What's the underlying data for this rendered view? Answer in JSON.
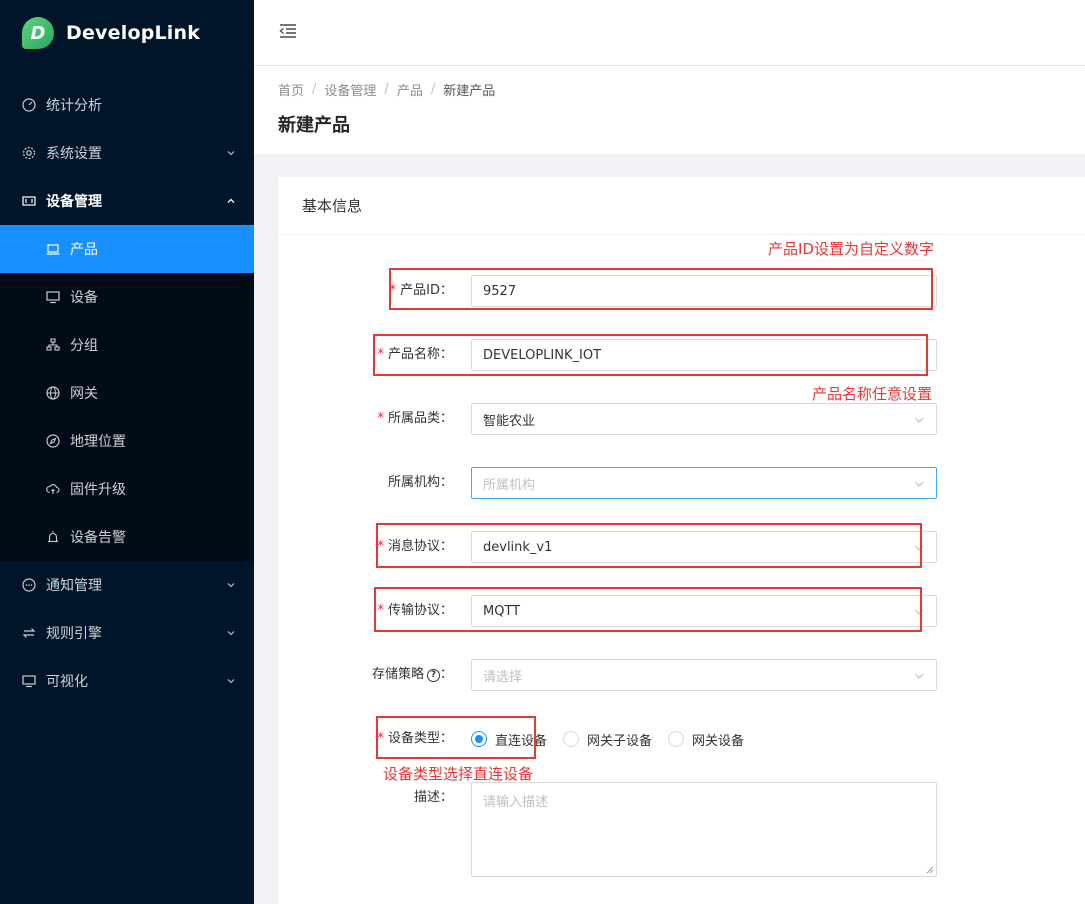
{
  "app": {
    "name": "DevelopLink",
    "logo_letter": "D"
  },
  "sidebar": {
    "items": [
      {
        "label": "统计分析",
        "icon": "dashboard-icon",
        "has_arrow": false
      },
      {
        "label": "系统设置",
        "icon": "gear-icon",
        "has_arrow": true
      },
      {
        "label": "设备管理",
        "icon": "device-manage-icon",
        "has_arrow": true,
        "open": true
      },
      {
        "label": "通知管理",
        "icon": "message-icon",
        "has_arrow": true
      },
      {
        "label": "规则引擎",
        "icon": "swap-icon",
        "has_arrow": true
      },
      {
        "label": "可视化",
        "icon": "monitor-icon",
        "has_arrow": true
      }
    ],
    "sub_items": [
      {
        "label": "产品",
        "icon": "laptop-icon",
        "active": true
      },
      {
        "label": "设备",
        "icon": "desktop-icon"
      },
      {
        "label": "分组",
        "icon": "cluster-icon"
      },
      {
        "label": "网关",
        "icon": "globe-icon"
      },
      {
        "label": "地理位置",
        "icon": "compass-icon"
      },
      {
        "label": "固件升级",
        "icon": "cloud-upload-icon"
      },
      {
        "label": "设备告警",
        "icon": "alarm-icon"
      }
    ]
  },
  "breadcrumb": [
    "首页",
    "设备管理",
    "产品",
    "新建产品"
  ],
  "page": {
    "title": "新建产品",
    "card_title": "基本信息"
  },
  "form": {
    "product_id": {
      "label": "产品ID",
      "value": "9527",
      "required": true
    },
    "product_name": {
      "label": "产品名称",
      "value": "DEVELOPLINK_IOT",
      "required": true
    },
    "category": {
      "label": "所属品类",
      "value": "智能农业",
      "required": true
    },
    "org": {
      "label": "所属机构",
      "placeholder": "所属机构",
      "required": false
    },
    "message_protocol": {
      "label": "消息协议",
      "value": "devlink_v1",
      "required": true
    },
    "transport_protocol": {
      "label": "传输协议",
      "value": "MQTT",
      "required": true
    },
    "storage": {
      "label": "存储策略",
      "placeholder": "请选择",
      "required": false
    },
    "device_type": {
      "label": "设备类型",
      "required": true,
      "options": [
        "直连设备",
        "网关子设备",
        "网关设备"
      ],
      "selected": "直连设备"
    },
    "description": {
      "label": "描述",
      "placeholder": "请输入描述"
    }
  },
  "annotations": {
    "product_id_note": "产品ID设置为自定义数字",
    "product_name_note": "产品名称任意设置",
    "device_type_note": "设备类型选择直连设备"
  },
  "colors": {
    "sidebar_bg": "#001529",
    "accent": "#1890ff",
    "annotation": "#e53935"
  }
}
